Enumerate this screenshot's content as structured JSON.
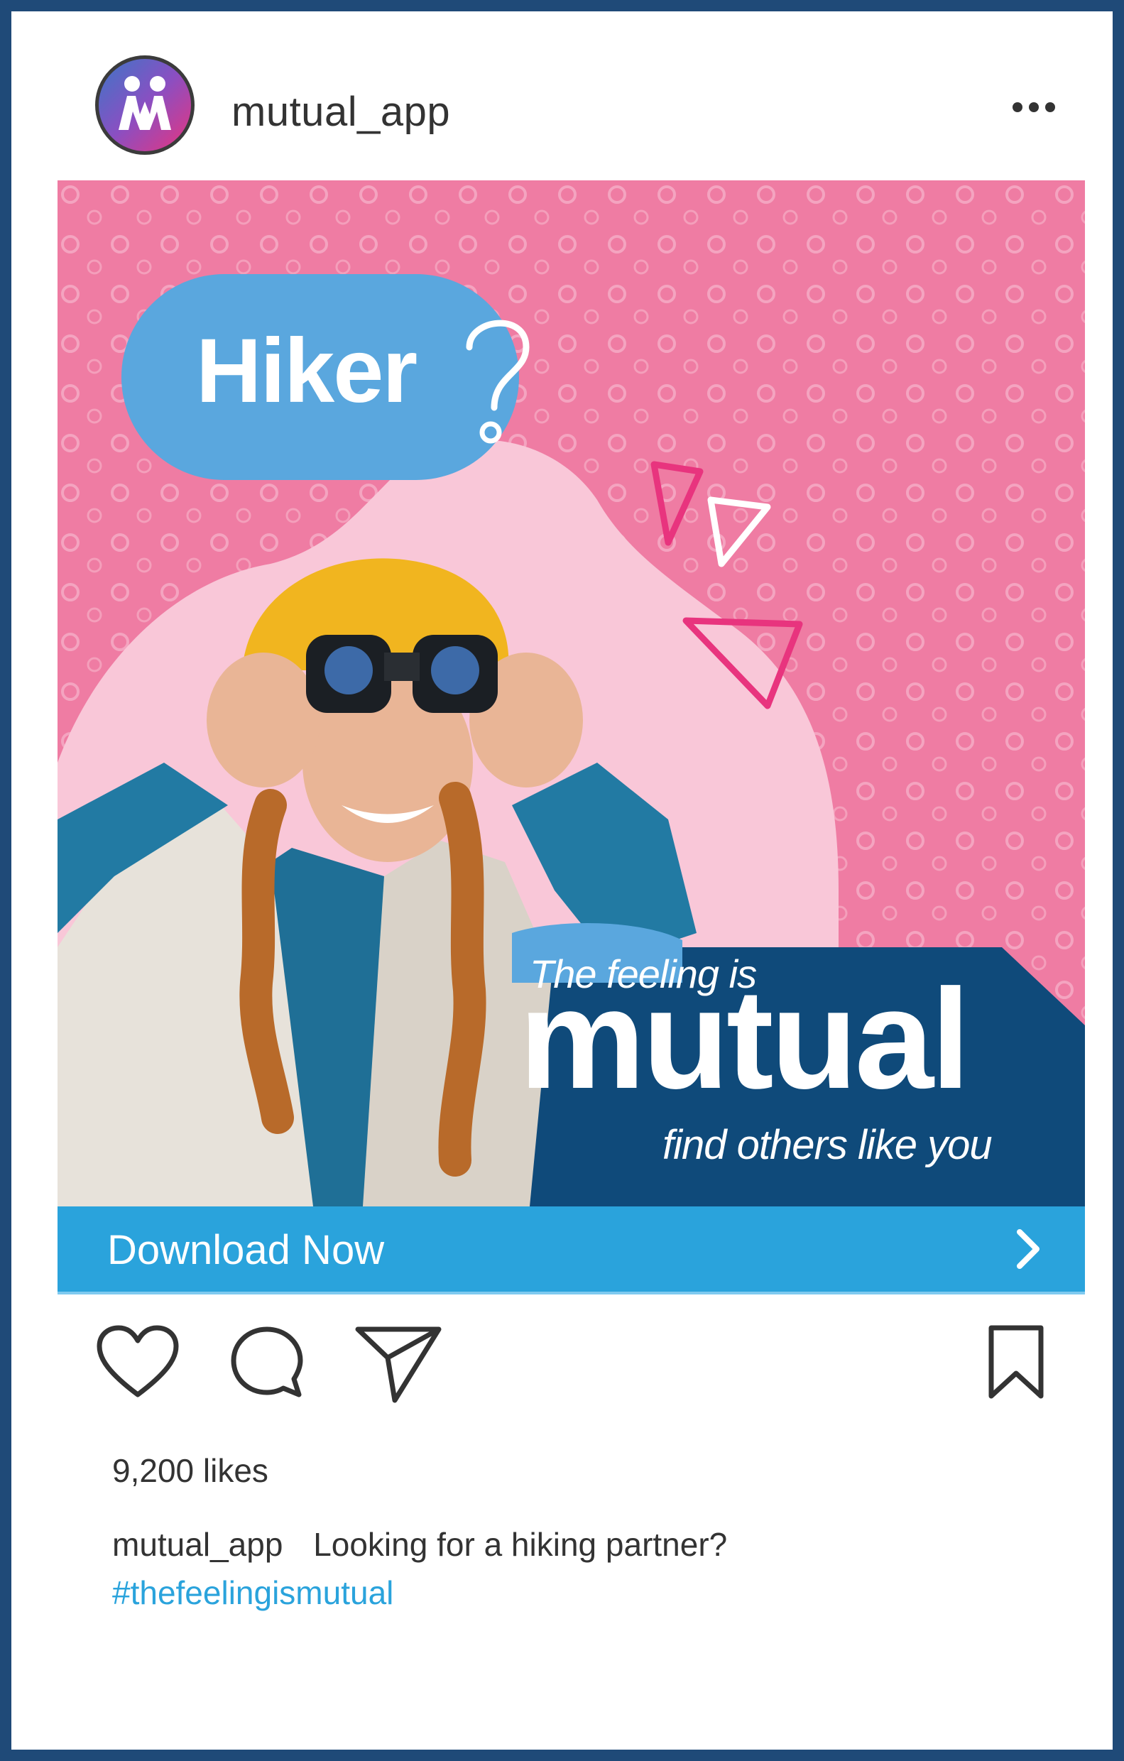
{
  "post": {
    "username": "mutual_app",
    "more_icon": "more-horizontal-icon",
    "avatar_icon": "mutual-logo-icon"
  },
  "ad": {
    "bubble_text": "Hiker",
    "tagline_top": "The feeling is",
    "tagline_main": "mutual",
    "tagline_sub": "find others like you",
    "colors": {
      "background": "#ef7ca3",
      "bubble": "#5aa7de",
      "tagline_block": "#0f4a7a",
      "accent_pink": "#e8347e"
    }
  },
  "cta": {
    "label": "Download Now",
    "arrow_icon": "chevron-right-icon",
    "color": "#2aa3dc"
  },
  "actions": {
    "like_icon": "heart-icon",
    "comment_icon": "comment-icon",
    "share_icon": "send-icon",
    "save_icon": "bookmark-icon"
  },
  "stats": {
    "likes": "9,200 likes"
  },
  "caption": {
    "username": "mutual_app",
    "text": "Looking for a hiking partner?",
    "hashtag": "#thefeelingismutual"
  }
}
